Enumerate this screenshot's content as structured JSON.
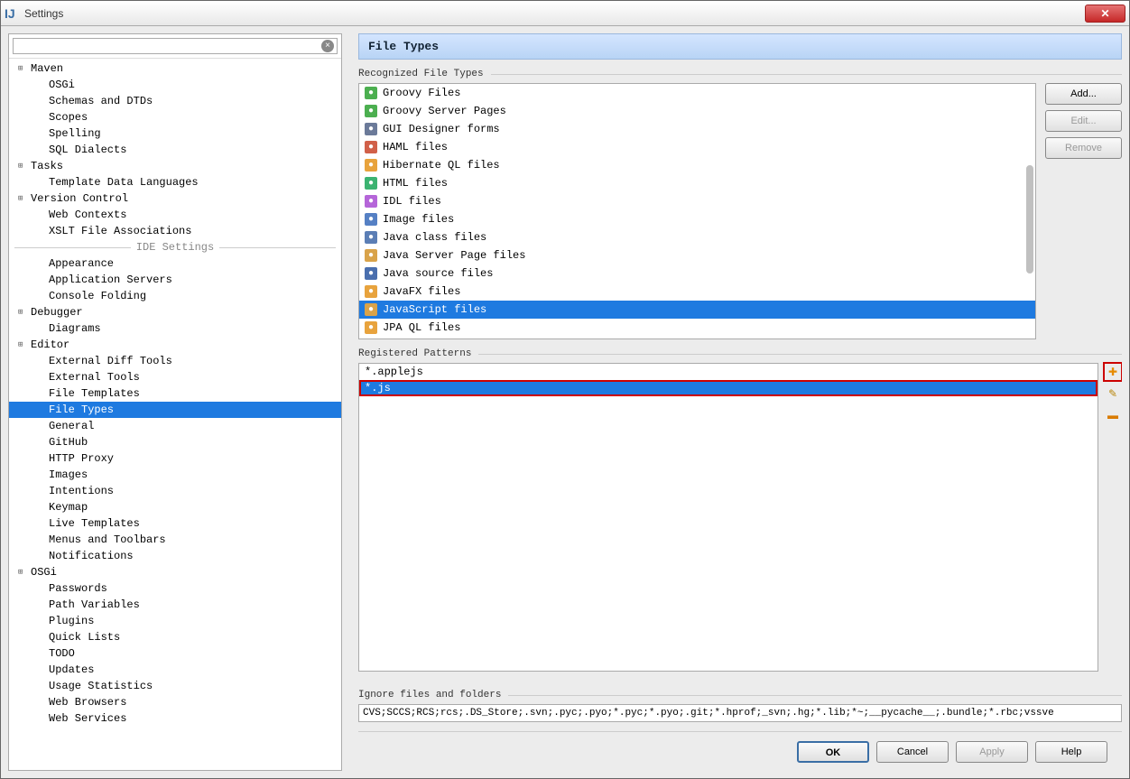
{
  "window": {
    "title": "Settings"
  },
  "sidebar": {
    "search_placeholder": "",
    "section_label": "IDE Settings",
    "items_top": [
      {
        "label": "Maven",
        "exp": true,
        "child": false
      },
      {
        "label": "OSGi",
        "exp": false,
        "child": true
      },
      {
        "label": "Schemas and DTDs",
        "exp": false,
        "child": true
      },
      {
        "label": "Scopes",
        "exp": false,
        "child": true
      },
      {
        "label": "Spelling",
        "exp": false,
        "child": true
      },
      {
        "label": "SQL Dialects",
        "exp": false,
        "child": true
      },
      {
        "label": "Tasks",
        "exp": true,
        "child": false
      },
      {
        "label": "Template Data Languages",
        "exp": false,
        "child": true
      },
      {
        "label": "Version Control",
        "exp": true,
        "child": false
      },
      {
        "label": "Web Contexts",
        "exp": false,
        "child": true
      },
      {
        "label": "XSLT File Associations",
        "exp": false,
        "child": true
      }
    ],
    "items_bottom": [
      {
        "label": "Appearance",
        "exp": false,
        "child": true
      },
      {
        "label": "Application Servers",
        "exp": false,
        "child": true
      },
      {
        "label": "Console Folding",
        "exp": false,
        "child": true
      },
      {
        "label": "Debugger",
        "exp": true,
        "child": false
      },
      {
        "label": "Diagrams",
        "exp": false,
        "child": true
      },
      {
        "label": "Editor",
        "exp": true,
        "child": false
      },
      {
        "label": "External Diff Tools",
        "exp": false,
        "child": true
      },
      {
        "label": "External Tools",
        "exp": false,
        "child": true
      },
      {
        "label": "File Templates",
        "exp": false,
        "child": true
      },
      {
        "label": "File Types",
        "exp": false,
        "child": true,
        "selected": true
      },
      {
        "label": "General",
        "exp": false,
        "child": true
      },
      {
        "label": "GitHub",
        "exp": false,
        "child": true
      },
      {
        "label": "HTTP Proxy",
        "exp": false,
        "child": true
      },
      {
        "label": "Images",
        "exp": false,
        "child": true
      },
      {
        "label": "Intentions",
        "exp": false,
        "child": true
      },
      {
        "label": "Keymap",
        "exp": false,
        "child": true
      },
      {
        "label": "Live Templates",
        "exp": false,
        "child": true
      },
      {
        "label": "Menus and Toolbars",
        "exp": false,
        "child": true
      },
      {
        "label": "Notifications",
        "exp": false,
        "child": true
      },
      {
        "label": "OSGi",
        "exp": true,
        "child": false
      },
      {
        "label": "Passwords",
        "exp": false,
        "child": true
      },
      {
        "label": "Path Variables",
        "exp": false,
        "child": true
      },
      {
        "label": "Plugins",
        "exp": false,
        "child": true
      },
      {
        "label": "Quick Lists",
        "exp": false,
        "child": true
      },
      {
        "label": "TODO",
        "exp": false,
        "child": true
      },
      {
        "label": "Updates",
        "exp": false,
        "child": true
      },
      {
        "label": "Usage Statistics",
        "exp": false,
        "child": true
      },
      {
        "label": "Web Browsers",
        "exp": false,
        "child": true
      },
      {
        "label": "Web Services",
        "exp": false,
        "child": true
      }
    ]
  },
  "main": {
    "title": "File Types",
    "recognized_label": "Recognized File Types",
    "buttons": {
      "add": "Add...",
      "edit": "Edit...",
      "remove": "Remove"
    },
    "file_types": [
      {
        "label": "Groovy Files",
        "color": "#4caf50"
      },
      {
        "label": "Groovy Server Pages",
        "color": "#4caf50"
      },
      {
        "label": "GUI Designer forms",
        "color": "#6b7a99"
      },
      {
        "label": "HAML files",
        "color": "#d16049"
      },
      {
        "label": "Hibernate QL files",
        "color": "#e8a33d"
      },
      {
        "label": "HTML files",
        "color": "#3cb371"
      },
      {
        "label": "IDL files",
        "color": "#b565d9"
      },
      {
        "label": "Image files",
        "color": "#5580c4"
      },
      {
        "label": "Java class files",
        "color": "#5b7eb5"
      },
      {
        "label": "Java Server Page files",
        "color": "#d9a34a"
      },
      {
        "label": "Java source files",
        "color": "#4a6fae"
      },
      {
        "label": "JavaFX files",
        "color": "#e8a33d"
      },
      {
        "label": "JavaScript files",
        "color": "#d9a34a",
        "selected": true
      },
      {
        "label": "JPA QL files",
        "color": "#e8a33d"
      }
    ],
    "patterns_label": "Registered Patterns",
    "patterns": [
      {
        "label": "*.applejs"
      },
      {
        "label": "*.js",
        "selected": true,
        "highlight": true
      }
    ],
    "ignore_label": "Ignore files and folders",
    "ignore_value": "CVS;SCCS;RCS;rcs;.DS_Store;.svn;.pyc;.pyo;*.pyc;*.pyo;.git;*.hprof;_svn;.hg;*.lib;*~;__pycache__;.bundle;*.rbc;vssve"
  },
  "footer": {
    "ok": "OK",
    "cancel": "Cancel",
    "apply": "Apply",
    "help": "Help"
  }
}
